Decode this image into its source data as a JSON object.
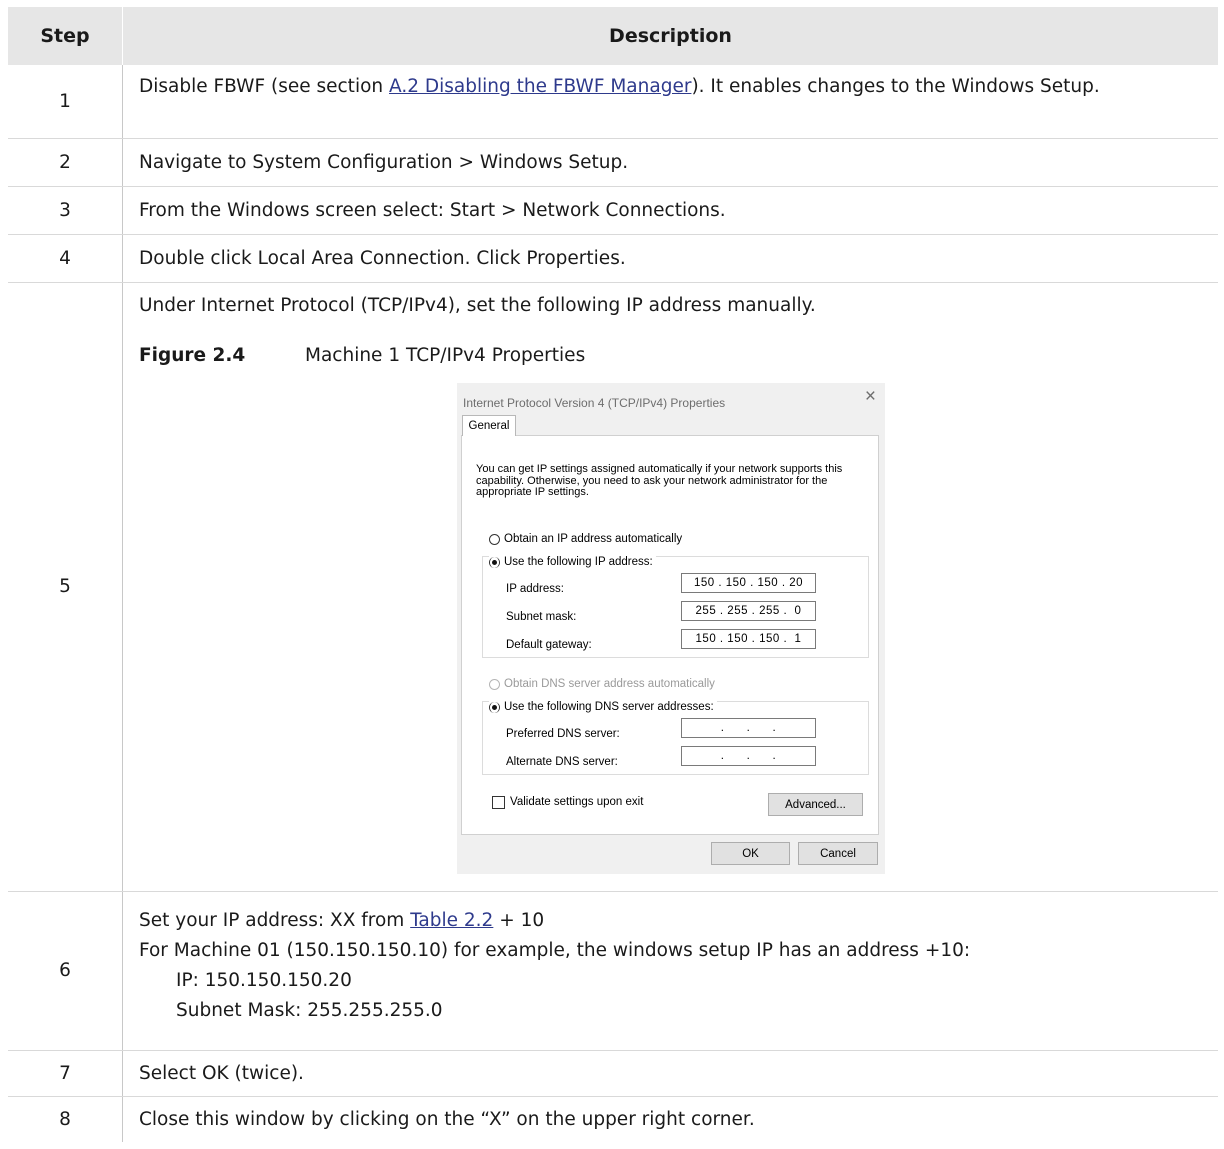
{
  "table": {
    "headers": {
      "step": "Step",
      "description": "Description"
    },
    "rows": [
      {
        "step": "1",
        "before": "Disable FBWF (see section ",
        "link": "A.2 Disabling the FBWF Manager",
        "after": "). It enables changes to the Windows Setup."
      },
      {
        "step": "2",
        "text": "Navigate to System Configuration > Windows Setup."
      },
      {
        "step": "3",
        "text": "From the Windows screen select: Start > Network Connections."
      },
      {
        "step": "4",
        "text": "Double click Local Area Connection. Click Properties."
      },
      {
        "step": "5",
        "text": "Under Internet Protocol (TCP/IPv4), set the following IP address manually."
      },
      {
        "step": "6",
        "line1_before": "Set your IP address: XX from ",
        "line1_link": "Table 2.2",
        "line1_after": " + 10",
        "line2": "For Machine 01 (150.150.150.10) for example, the windows setup IP has an address +10:",
        "line3": "IP: 150.150.150.20",
        "line4": "Subnet Mask: 255.255.255.0"
      },
      {
        "step": "7",
        "text": "Select OK (twice)."
      },
      {
        "step": "8",
        "text": "Close this window by clicking on the “X” on the upper right corner."
      }
    ]
  },
  "figure": {
    "number": "Figure 2.4",
    "caption": "Machine 1 TCP/IPv4 Properties"
  },
  "dialog": {
    "title": "Internet Protocol Version 4 (TCP/IPv4) Properties",
    "close_icon": "×",
    "tab": "General",
    "intro": "You can get IP settings assigned automatically if your network supports this capability. Otherwise, you need to ask your network administrator for the appropriate IP settings.",
    "radio_obtain_ip": "Obtain an IP address automatically",
    "radio_use_ip": "Use the following IP address:",
    "ip_label": "IP address:",
    "ip_value": "150 . 150 . 150 . 20",
    "subnet_label": "Subnet mask:",
    "subnet_value": "255 . 255 . 255 .  0",
    "gateway_label": "Default gateway:",
    "gateway_value": "150 . 150 . 150 .  1",
    "radio_obtain_dns": "Obtain DNS server address automatically",
    "radio_use_dns": "Use the following DNS server addresses:",
    "preferred_dns_label": "Preferred DNS server:",
    "preferred_dns_value": ".      .      .",
    "alternate_dns_label": "Alternate DNS server:",
    "alternate_dns_value": ".      .      .",
    "validate_label": "Validate settings upon exit",
    "advanced_button": "Advanced...",
    "ok_button": "OK",
    "cancel_button": "Cancel"
  }
}
